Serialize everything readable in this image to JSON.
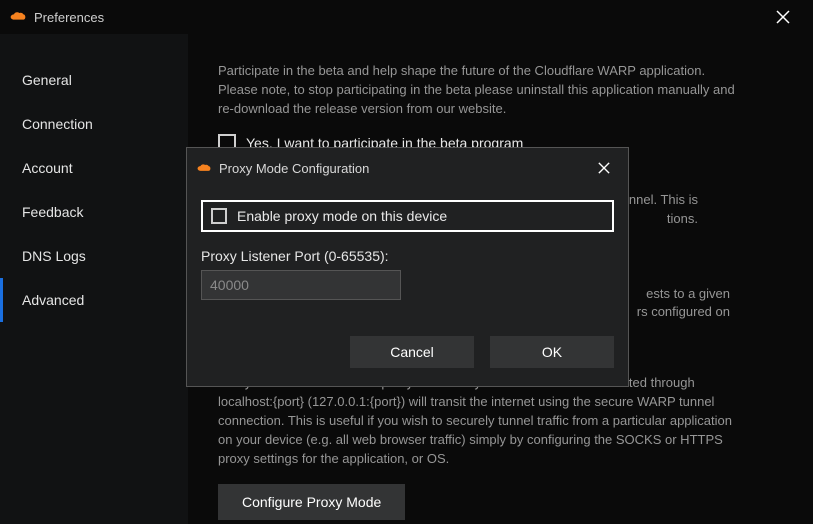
{
  "window": {
    "title": "Preferences"
  },
  "sidebar": {
    "items": [
      {
        "label": "General"
      },
      {
        "label": "Connection"
      },
      {
        "label": "Account"
      },
      {
        "label": "Feedback"
      },
      {
        "label": "DNS Logs"
      },
      {
        "label": "Advanced"
      }
    ],
    "active_index": 5
  },
  "content": {
    "beta_desc": "Participate in the beta and help shape the future of the Cloudflare WARP application. Please note, to stop participating in the beta please uninstall this application manually and re-download the release version from our website.",
    "beta_checkbox_label": "Yes, I want to participate in the beta program",
    "obscured_line_1_tail": "tunnel. This is",
    "obscured_line_2_tail": "tions.",
    "obscured_line_3_tail": "ests to a given",
    "obscured_line_4_tail": "rs configured on",
    "proxy_desc": "Proxy mode enables a local proxy server on your device. All traffic directed through localhost:{port} (127.0.0.1:{port}) will transit the internet using the secure WARP tunnel connection. This is useful if you wish to securely tunnel traffic from a particular application on your device (e.g. all web browser traffic) simply by configuring the SOCKS or HTTPS proxy settings for the application, or OS.",
    "configure_proxy_btn": "Configure Proxy Mode"
  },
  "dialog": {
    "title": "Proxy Mode Configuration",
    "enable_label": "Enable proxy mode on this device",
    "port_label": "Proxy Listener Port (0-65535):",
    "port_value": "40000",
    "cancel": "Cancel",
    "ok": "OK"
  }
}
